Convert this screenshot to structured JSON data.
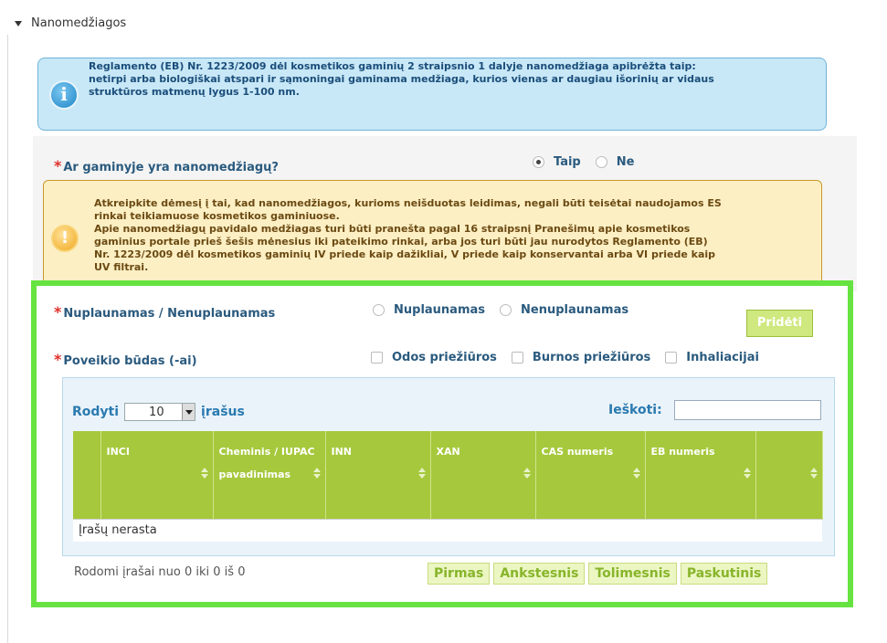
{
  "section": {
    "title": "Nanomedžiagos"
  },
  "info": {
    "text": "Reglamento (EB) Nr. 1223/2009 dėl kosmetikos gaminių 2 straipsnio 1 dalyje nanomedžiaga apibrėžta taip:\nnetirpi arba biologiškai atspari ir sąmoningai gaminama medžiaga, kurios vienas ar daugiau išorinių ar vidaus\nstruktūros matmenų lygus 1-100 nm."
  },
  "question": {
    "label": "Ar gaminyje yra nanomedžiagų?",
    "options": [
      "Taip",
      "Ne"
    ],
    "selected": "Taip"
  },
  "warning": {
    "text": "Atkreipkite dėmesį į tai, kad nanomedžiagos, kurioms neišduotas leidimas, negali būti teisėtai naudojamos ES\nrinkai teikiamuose kosmetikos gaminiuose.\nApie nanomedžiagų pavidalo medžiagas turi būti pranešta pagal 16 straipsnį Pranešimų apie kosmetikos\ngaminius portale prieš šešis mėnesius iki pateikimo rinkai, arba jos turi būti jau nurodytos Reglamento (EB)\nNr. 1223/2009 dėl kosmetikos gaminių IV priede kaip dažikliai, V priede kaip konservantai arba VI priede kaip\nUV filtrai."
  },
  "rinse": {
    "label": "Nuplaunamas / Nenuplaunamas",
    "options": [
      "Nuplaunamas",
      "Nenuplaunamas"
    ]
  },
  "exposure": {
    "label": "Poveikio būdas (-ai)",
    "options": [
      "Odos priežiūros",
      "Burnos priežiūros",
      "Inhaliacijai"
    ]
  },
  "add_button": "Pridėti",
  "table": {
    "show_prefix": "Rodyti",
    "page_size": "10",
    "show_suffix": "įrašus",
    "search_label": "Ieškoti:",
    "columns": [
      "INCI",
      "Cheminis / IUPAC pavadinimas",
      "INN",
      "XAN",
      "CAS numeris",
      "EB numeris",
      ""
    ],
    "empty": "Įrašų nerasta",
    "info": "Rodomi įrašai nuo 0 iki 0 iš 0",
    "pager": [
      "Pirmas",
      "Ankstesnis",
      "Tolimesnis",
      "Paskutinis"
    ]
  },
  "colors": {
    "accent_green": "#66e341",
    "header_green": "#a6c83c",
    "label_blue": "#2a5a7e",
    "required_red": "#e0302c"
  }
}
